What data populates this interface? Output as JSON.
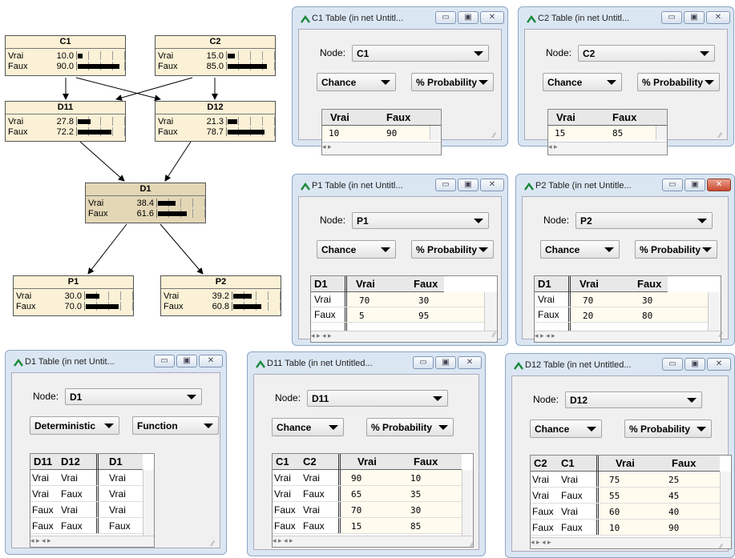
{
  "network": {
    "nodes": [
      {
        "name": "C1",
        "states": [
          {
            "label": "Vrai",
            "value": "10.0",
            "p": 0.1
          },
          {
            "label": "Faux",
            "value": "90.0",
            "p": 0.9
          }
        ]
      },
      {
        "name": "C2",
        "states": [
          {
            "label": "Vrai",
            "value": "15.0",
            "p": 0.15
          },
          {
            "label": "Faux",
            "value": "85.0",
            "p": 0.85
          }
        ]
      },
      {
        "name": "D11",
        "states": [
          {
            "label": "Vrai",
            "value": "27.8",
            "p": 0.278
          },
          {
            "label": "Faux",
            "value": "72.2",
            "p": 0.722
          }
        ]
      },
      {
        "name": "D12",
        "states": [
          {
            "label": "Vrai",
            "value": "21.3",
            "p": 0.213
          },
          {
            "label": "Faux",
            "value": "78.7",
            "p": 0.787
          }
        ]
      },
      {
        "name": "D1",
        "states": [
          {
            "label": "Vrai",
            "value": "38.4",
            "p": 0.384
          },
          {
            "label": "Faux",
            "value": "61.6",
            "p": 0.616
          }
        ]
      },
      {
        "name": "P1",
        "states": [
          {
            "label": "Vrai",
            "value": "30.0",
            "p": 0.3
          },
          {
            "label": "Faux",
            "value": "70.0",
            "p": 0.7
          }
        ]
      },
      {
        "name": "P2",
        "states": [
          {
            "label": "Vrai",
            "value": "39.2",
            "p": 0.392
          },
          {
            "label": "Faux",
            "value": "60.8",
            "p": 0.608
          }
        ]
      }
    ]
  },
  "common": {
    "node_label": "Node:",
    "minimize": "▭",
    "maximize": "▣",
    "close": "✕"
  },
  "windows": {
    "c1": {
      "title": "C1 Table (in net Untitl...",
      "node": "C1",
      "kind": "Chance",
      "fmt": "% Probability",
      "headers": [
        "Vrai",
        "Faux"
      ],
      "row": [
        "10",
        "90"
      ]
    },
    "c2": {
      "title": "C2 Table (in net Untitl...",
      "node": "C2",
      "kind": "Chance",
      "fmt": "% Probability",
      "headers": [
        "Vrai",
        "Faux"
      ],
      "row": [
        "15",
        "85"
      ]
    },
    "p1": {
      "title": "P1 Table (in net Untitl...",
      "node": "P1",
      "kind": "Chance",
      "fmt": "% Probability",
      "parent": "D1",
      "headers": [
        "Vrai",
        "Faux"
      ],
      "rows": [
        {
          "p": "Vrai",
          "v": [
            "70",
            "30"
          ]
        },
        {
          "p": "Faux",
          "v": [
            "5",
            "95"
          ]
        }
      ]
    },
    "p2": {
      "title": "P2 Table (in net Untitle...",
      "node": "P2",
      "kind": "Chance",
      "fmt": "% Probability",
      "parent": "D1",
      "headers": [
        "Vrai",
        "Faux"
      ],
      "rows": [
        {
          "p": "Vrai",
          "v": [
            "70",
            "30"
          ]
        },
        {
          "p": "Faux",
          "v": [
            "20",
            "80"
          ]
        }
      ]
    },
    "d1": {
      "title": "D1 Table (in net Untit...",
      "node": "D1",
      "kind": "Deterministic",
      "fmt": "Function",
      "parents": [
        "D11",
        "D12"
      ],
      "header": "D1",
      "rows": [
        {
          "p": [
            "Vrai",
            "Vrai"
          ],
          "v": "Vrai"
        },
        {
          "p": [
            "Vrai",
            "Faux"
          ],
          "v": "Vrai"
        },
        {
          "p": [
            "Faux",
            "Vrai"
          ],
          "v": "Vrai"
        },
        {
          "p": [
            "Faux",
            "Faux"
          ],
          "v": "Faux"
        }
      ]
    },
    "d11": {
      "title": "D11 Table (in net Untitled...",
      "node": "D11",
      "kind": "Chance",
      "fmt": "% Probability",
      "parents": [
        "C1",
        "C2"
      ],
      "headers": [
        "Vrai",
        "Faux"
      ],
      "rows": [
        {
          "p": [
            "Vrai",
            "Vrai"
          ],
          "v": [
            "90",
            "10"
          ]
        },
        {
          "p": [
            "Vrai",
            "Faux"
          ],
          "v": [
            "65",
            "35"
          ]
        },
        {
          "p": [
            "Faux",
            "Vrai"
          ],
          "v": [
            "70",
            "30"
          ]
        },
        {
          "p": [
            "Faux",
            "Faux"
          ],
          "v": [
            "15",
            "85"
          ]
        }
      ]
    },
    "d12": {
      "title": "D12 Table (in net Untitled...",
      "node": "D12",
      "kind": "Chance",
      "fmt": "% Probability",
      "parents": [
        "C2",
        "C1"
      ],
      "headers": [
        "Vrai",
        "Faux"
      ],
      "rows": [
        {
          "p": [
            "Vrai",
            "Vrai"
          ],
          "v": [
            "75",
            "25"
          ]
        },
        {
          "p": [
            "Vrai",
            "Faux"
          ],
          "v": [
            "55",
            "45"
          ]
        },
        {
          "p": [
            "Faux",
            "Vrai"
          ],
          "v": [
            "60",
            "40"
          ]
        },
        {
          "p": [
            "Faux",
            "Faux"
          ],
          "v": [
            "10",
            "90"
          ]
        }
      ]
    }
  }
}
